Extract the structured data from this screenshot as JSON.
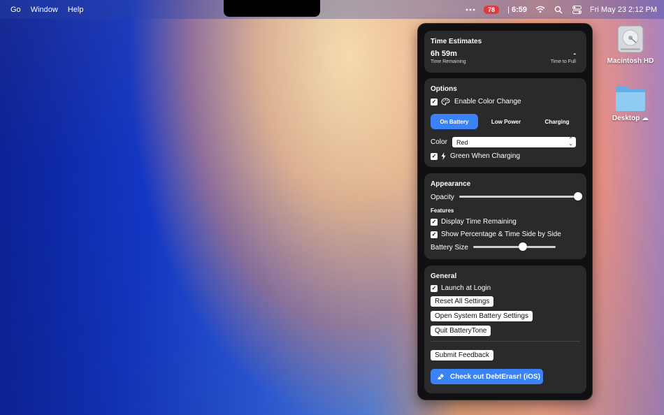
{
  "menubar": {
    "items": [
      "Go",
      "Window",
      "Help"
    ],
    "battery_badge": "78",
    "time_remaining": "6:59",
    "datetime": "Fri May 23  2:12 PM"
  },
  "desktop": {
    "icons": [
      {
        "label": "Macintosh HD",
        "icon": "harddrive-icon"
      },
      {
        "label": "Desktop",
        "icon": "folder-icon"
      }
    ]
  },
  "panel": {
    "time_estimates": {
      "title": "Time Estimates",
      "remaining_value": "6h 59m",
      "remaining_label": "Time Remaining",
      "full_value": "-",
      "full_label": "Time to Full"
    },
    "options": {
      "title": "Options",
      "enable_color_change": "Enable Color Change",
      "tabs": [
        "On Battery",
        "Low Power",
        "Charging"
      ],
      "active_tab": "On Battery",
      "color_label": "Color",
      "color_value": "Red",
      "green_when_charging": "Green When Charging"
    },
    "appearance": {
      "title": "Appearance",
      "opacity_label": "Opacity",
      "opacity_value": 1.0,
      "features_label": "Features",
      "display_time_remaining": "Display Time Remaining",
      "show_side_by_side": "Show Percentage & Time Side by Side",
      "battery_size_label": "Battery Size",
      "battery_size_value": 0.6
    },
    "general": {
      "title": "General",
      "launch_at_login": "Launch at Login",
      "reset_button": "Reset All Settings",
      "open_settings_button": "Open System Battery Settings",
      "quit_button": "Quit BatteryTone",
      "feedback_button": "Submit Feedback",
      "promo_button": "Check out DebtErasr! (iOS)"
    }
  },
  "colors": {
    "accent": "#3b82f6",
    "battery_badge": "#e03b3b",
    "panel_bg": "#101012",
    "card_bg": "#2a2a2c"
  }
}
